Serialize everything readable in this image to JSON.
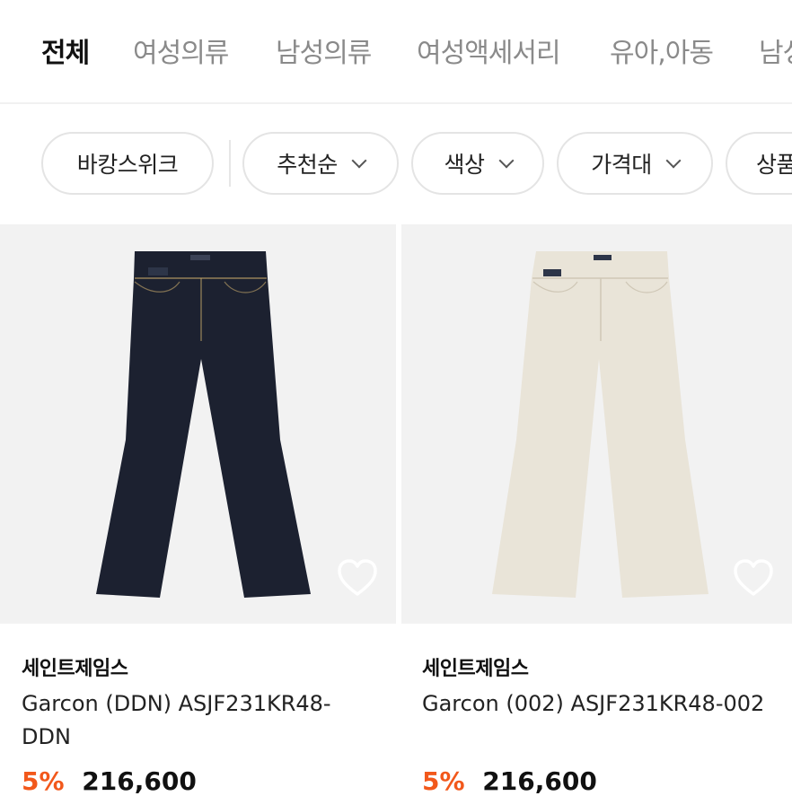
{
  "category_tabs": [
    {
      "label": "전체",
      "active": true
    },
    {
      "label": "여성의류",
      "active": false
    },
    {
      "label": "남성의류",
      "active": false
    },
    {
      "label": "여성액세서리",
      "active": false
    },
    {
      "label": "유아,아동",
      "active": false
    },
    {
      "label": "남성",
      "active": false
    }
  ],
  "filters": {
    "primary": "바캉스위크",
    "chips": [
      {
        "label": "추천순",
        "icon": "chevron-down-icon"
      },
      {
        "label": "색상",
        "icon": "chevron-down-icon"
      },
      {
        "label": "가격대",
        "icon": "chevron-down-icon"
      },
      {
        "label": "상품",
        "icon": ""
      }
    ]
  },
  "products": [
    {
      "brand": "세인트제임스",
      "name": "Garcon (DDN) ASJF231KR48-DDN",
      "discount": "5%",
      "price": "216,600",
      "image_color": "#1c2130",
      "favorite_icon": "heart-outline-icon"
    },
    {
      "brand": "세인트제임스",
      "name": "Garcon (002) ASJF231KR48-002",
      "discount": "5%",
      "price": "216,600",
      "image_color": "#e9e4d8",
      "favorite_icon": "heart-outline-icon"
    }
  ],
  "colors": {
    "accent_discount": "#f2581b",
    "active_tab": "#111111",
    "inactive_tab": "#8a8a8a"
  }
}
